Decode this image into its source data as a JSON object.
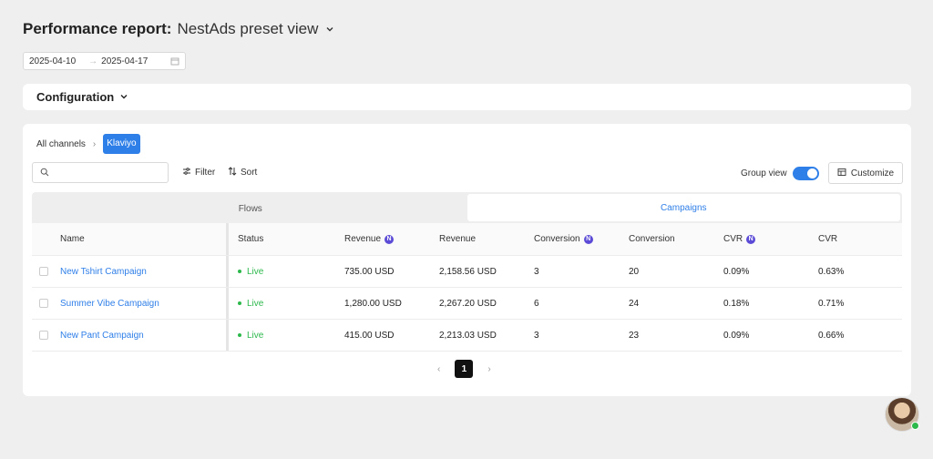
{
  "header": {
    "title": "Performance report:",
    "view": "NestAds preset view"
  },
  "date_range": {
    "start": "2025-04-10",
    "end": "2025-04-17"
  },
  "configuration": {
    "label": "Configuration"
  },
  "breadcrumb": {
    "root": "All channels",
    "current": "Klaviyo"
  },
  "toolbar": {
    "search_placeholder": "",
    "filter_label": "Filter",
    "sort_label": "Sort",
    "group_view_label": "Group view",
    "group_view_on": true,
    "customize_label": "Customize"
  },
  "tabs": [
    {
      "label": "Flows",
      "selected": false
    },
    {
      "label": "Campaigns",
      "selected": true
    }
  ],
  "table": {
    "columns": [
      "Name",
      "Status",
      "Revenue",
      "Revenue",
      "Conversion",
      "Conversion",
      "CVR",
      "CVR"
    ],
    "rows": [
      {
        "name": "New Tshirt Campaign",
        "status": "Live",
        "revenue1": "735.00 USD",
        "revenue2": "2,158.56 USD",
        "conversion1": "3",
        "conversion2": "20",
        "cvr1": "0.09%",
        "cvr2": "0.63%"
      },
      {
        "name": "Summer Vibe Campaign",
        "status": "Live",
        "revenue1": "1,280.00 USD",
        "revenue2": "2,267.20 USD",
        "conversion1": "6",
        "conversion2": "24",
        "cvr1": "0.18%",
        "cvr2": "0.71%"
      },
      {
        "name": "New Pant Campaign",
        "status": "Live",
        "revenue1": "415.00 USD",
        "revenue2": "2,213.03 USD",
        "conversion1": "3",
        "conversion2": "23",
        "cvr1": "0.09%",
        "cvr2": "0.66%"
      }
    ]
  },
  "pagination": {
    "current_page": "1",
    "prev": "‹",
    "next": "›"
  },
  "colors": {
    "accent": "#2f7fe8",
    "live": "#2db84c",
    "info_badge": "#5b4bd6"
  }
}
